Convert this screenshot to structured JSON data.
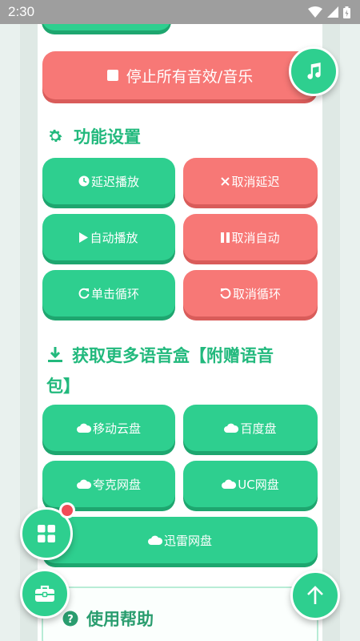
{
  "status_bar": {
    "time": "2:30"
  },
  "stop_button": {
    "label": "停止所有音效/音乐"
  },
  "settings": {
    "title": "功能设置",
    "buttons": [
      {
        "label": "延迟播放"
      },
      {
        "label": "取消延迟"
      },
      {
        "label": "自动播放"
      },
      {
        "label": "取消自动"
      },
      {
        "label": "单击循环"
      },
      {
        "label": "取消循环"
      }
    ]
  },
  "more": {
    "title_line1": "获取更多语音盒【附赠语音",
    "title_line2": "包】",
    "buttons": [
      {
        "label": "移动云盘"
      },
      {
        "label": "百度盘"
      },
      {
        "label": "夸克网盘"
      },
      {
        "label": "UC网盘"
      },
      {
        "label": "迅雷网盘"
      }
    ]
  },
  "help": {
    "title": "使用帮助"
  },
  "colors": {
    "accent_green": "#2ecf8f",
    "accent_red": "#f77876",
    "title_green": "#22b97d",
    "badge_red": "#f24b58"
  },
  "icons": {
    "music_fab": "music-note-icon",
    "grid_fab": "grid-icon",
    "toolbox_fab": "toolbox-icon",
    "scroll_top_fab": "arrow-up-icon"
  }
}
